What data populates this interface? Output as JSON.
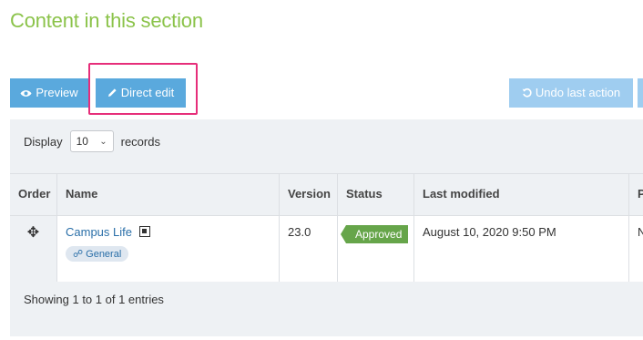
{
  "page": {
    "title": "Content in this section"
  },
  "toolbar": {
    "preview_label": "Preview",
    "direct_edit_label": "Direct edit",
    "undo_label": "Undo last action"
  },
  "display": {
    "prefix": "Display",
    "value": "10",
    "suffix": "records"
  },
  "table": {
    "headers": {
      "order": "Order",
      "name": "Name",
      "version": "Version",
      "status": "Status",
      "last_modified": "Last modified",
      "more": "P"
    },
    "rows": [
      {
        "name": "Campus Life",
        "tag": "General",
        "version": "23.0",
        "status": "Approved",
        "last_modified": "August 10, 2020 9:50 PM",
        "more": "N"
      }
    ]
  },
  "footer": {
    "text": "Showing 1 to 1 of 1 entries"
  },
  "colors": {
    "accent": "#5aa9dd",
    "heading": "#8bc34a",
    "approved": "#66a54a",
    "highlight": "#e62e7a"
  }
}
